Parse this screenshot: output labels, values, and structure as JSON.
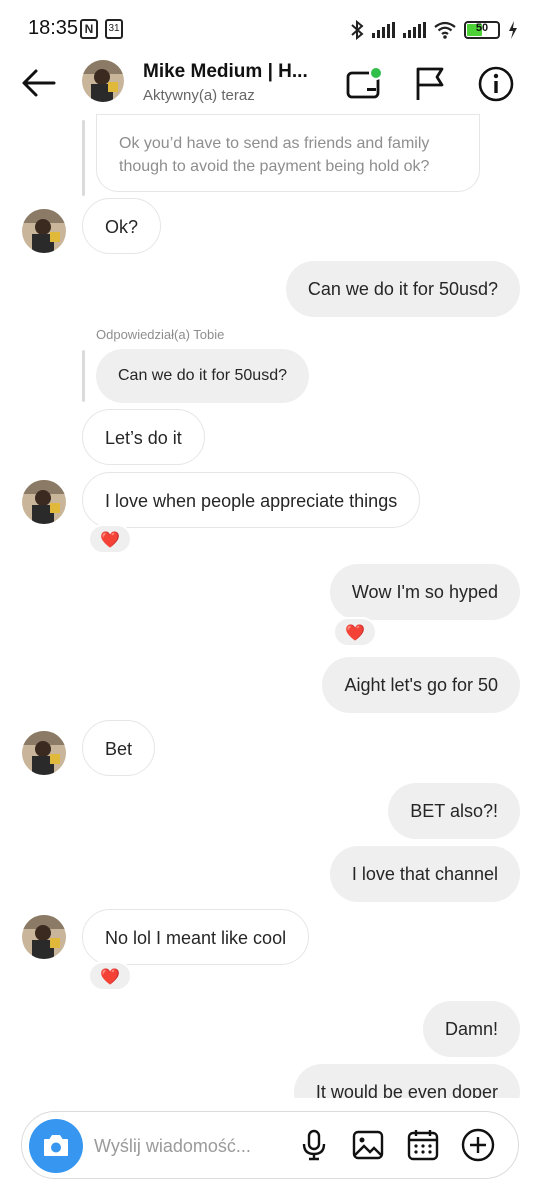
{
  "status_bar": {
    "time": "18:35",
    "nfc_icon_text": "N",
    "calendar_icon_text": "31",
    "battery_level": "50",
    "battery_color": "#4cd137"
  },
  "header": {
    "name": "Mike Medium | H...",
    "status": "Aktywny(a) teraz",
    "online_dot_color": "#2fbf4a"
  },
  "messages": {
    "quoted_top": "Ok you’d have to send as friends and family though to avoid the payment being hold ok?",
    "m1": "Ok?",
    "m2": "Can we do it for 50usd?",
    "replied_label": "Odpowiedział(a) Tobie",
    "m3_quote": "Can we do it for 50usd?",
    "m3": "Let’s do it",
    "m4": "I love when people appreciate things",
    "m5": "Wow I'm so hyped",
    "m6": "Aight let's go for 50",
    "m7": "Bet",
    "m8": "BET also?!",
    "m9": "I love that channel",
    "m10": "No lol I meant like cool",
    "m11": "Damn!",
    "m12": "It would be even doper",
    "reaction": "❤️"
  },
  "composer": {
    "placeholder": "Wyślij wiadomość..."
  },
  "colors": {
    "accent_blue": "#3797f0",
    "bubble_out": "#efefef",
    "heart": "#e0245e"
  }
}
